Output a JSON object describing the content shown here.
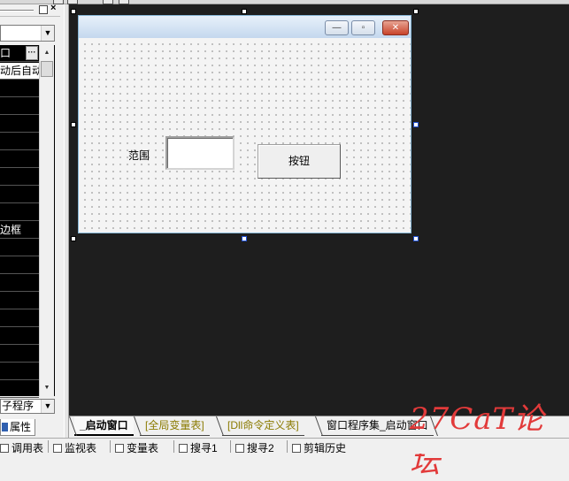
{
  "property_panel": {
    "close_glyph": "×",
    "grid_rows": [
      {
        "label": "口",
        "selected": false
      },
      {
        "label": "动后自动",
        "selected": true
      },
      {
        "label": "",
        "selected": false
      },
      {
        "label": "",
        "selected": false
      },
      {
        "label": "",
        "selected": false
      },
      {
        "label": "",
        "selected": false
      },
      {
        "label": "",
        "selected": false
      },
      {
        "label": "",
        "selected": false
      },
      {
        "label": "",
        "selected": false
      },
      {
        "label": "",
        "selected": false
      },
      {
        "label": "边框",
        "selected": false
      },
      {
        "label": "",
        "selected": false
      },
      {
        "label": "",
        "selected": false
      },
      {
        "label": "",
        "selected": false
      },
      {
        "label": "",
        "selected": false
      },
      {
        "label": "",
        "selected": false
      },
      {
        "label": "",
        "selected": false
      },
      {
        "label": "",
        "selected": false
      },
      {
        "label": "",
        "selected": false
      },
      {
        "label": "",
        "selected": false
      }
    ],
    "grid_button_label": "···",
    "event_combo_value": "子程序",
    "tab_label": "属性"
  },
  "form": {
    "label_text": "范围",
    "button_text": "按钮",
    "caption_buttons": {
      "minimize": "—",
      "maximize": "▫",
      "close": "✕"
    }
  },
  "tabs": [
    {
      "label": "_启动窗口",
      "style": "active"
    },
    {
      "label": "[全局变量表]",
      "style": "olive"
    },
    {
      "label": "[Dll命令定义表]",
      "style": "olive"
    },
    {
      "label": "窗口程序集_启动窗口",
      "style": "plain"
    }
  ],
  "watermark": "27CaT论坛",
  "status_bar": [
    {
      "label": "调用表"
    },
    {
      "label": "监视表"
    },
    {
      "label": "变量表"
    },
    {
      "label": "搜寻1"
    },
    {
      "label": "搜寻2"
    },
    {
      "label": "剪辑历史"
    }
  ],
  "colors": {
    "canvas": "#1e1e1e",
    "accent_red": "#e23a3a",
    "olive_tab_text": "#8a7a00",
    "handle_blue": "#2050d0"
  }
}
